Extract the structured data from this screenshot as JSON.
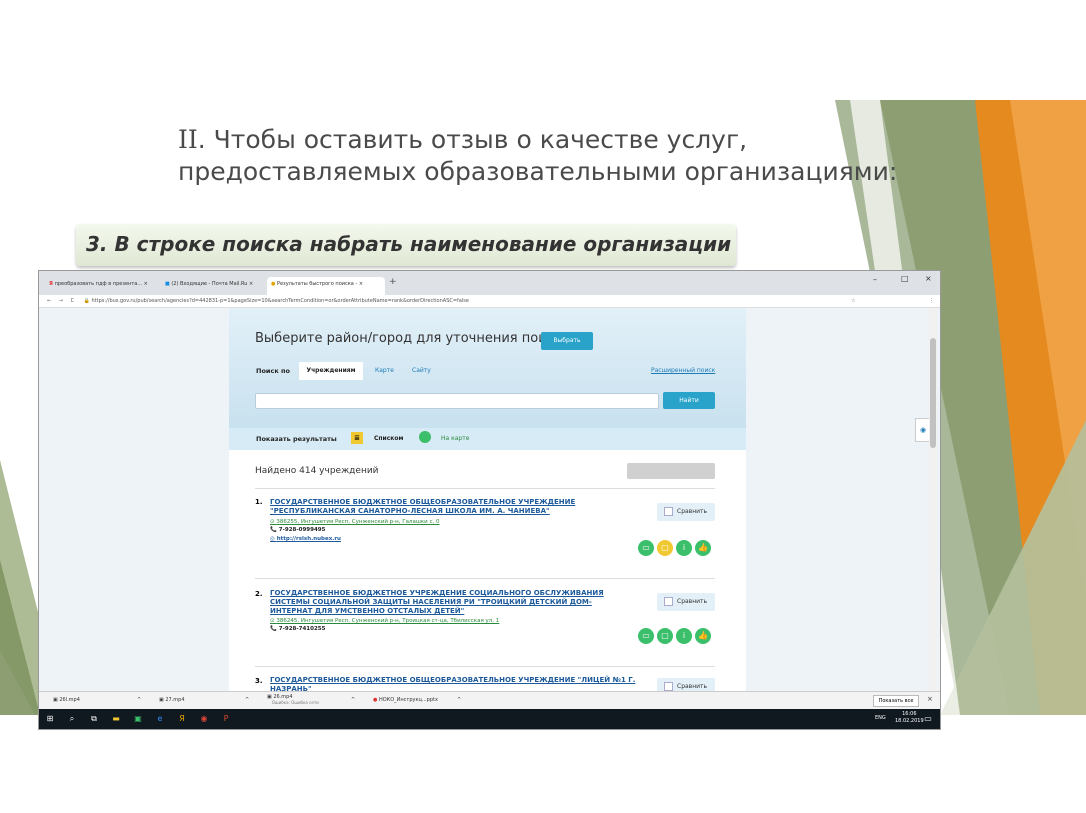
{
  "slide": {
    "title_roman": "II",
    "title_rest": ". Чтобы оставить отзыв о качестве услуг, предоставляемых образовательными организациями:",
    "step_text": "3. В строке поиска набрать наименование организации"
  },
  "browser": {
    "tabs": [
      {
        "label": "преобразовать пдф в презента..."
      },
      {
        "label": "(2) Входящие - Почта Mail.Ru"
      },
      {
        "label": "Результаты быстрого поиска -"
      }
    ],
    "address_url": "https://bus.gov.ru/pub/search/agencies?d=442831-p=1&pageSize=10&searchTermCondition=or&orderAttributeName=rank&orderDirectionASC=false"
  },
  "site": {
    "region_prompt": "Выберите район/город для уточнения поиска",
    "choose_button": "Выбрать",
    "search_by_label": "Поиск по",
    "tabs": [
      "Учреждениям",
      "Карте",
      "Сайту"
    ],
    "advanced_search": "Расширенный поиск",
    "search_input_value": "",
    "find_button": "Найти",
    "show_results_label": "Показать результаты",
    "view_list": "Списком",
    "view_map": "На карте",
    "found_count": "Найдено 414 учреждений",
    "compare_label": "Сравнить",
    "results": [
      {
        "num": "1.",
        "name": "ГОСУДАРСТВЕННОЕ БЮДЖЕТНОЕ ОБЩЕОБРАЗОВАТЕЛЬНОЕ УЧРЕЖДЕНИЕ \"РЕСПУБЛИКАНСКАЯ САНАТОРНО-ЛЕСНАЯ ШКОЛА ИМ. А. ЧАНИЕВА\"",
        "address": "386255, Ингушетия Респ, Сунженский р-н, Галашки с, 0",
        "phone": "7-928-0999495",
        "site": "http://rslsh.nubex.ru"
      },
      {
        "num": "2.",
        "name": "ГОСУДАРСТВЕННОЕ БЮДЖЕТНОЕ УЧРЕЖДЕНИЕ СОЦИАЛЬНОГО ОБСЛУЖИВАНИЯ СИСТЕМЫ СОЦИАЛЬНОЙ ЗАЩИТЫ НАСЕЛЕНИЯ РИ \"ТРОИЦКИЙ ДЕТСКИЙ ДОМ-ИНТЕРНАТ ДЛЯ УМСТВЕННО ОТСТАЛЫХ ДЕТЕЙ\"",
        "address": "386245, Ингушетия Респ, Сунженский р-н, Троицкая ст-ца, Тбилисская ул, 1",
        "phone": "7-928-7410255"
      },
      {
        "num": "3.",
        "name": "ГОСУДАРСТВЕННОЕ БЮДЖЕТНОЕ ОБЩЕОБРАЗОВАТЕЛЬНОЕ УЧРЕЖДЕНИЕ \"ЛИЦЕЙ №1 Г. НАЗРАНЬ\""
      }
    ]
  },
  "downloads": {
    "items": [
      "26l.mp4",
      "27.mp4",
      "26.mp4",
      "НОКО_Инструкц...pptx"
    ],
    "status_26": "Ошибка: Ошибка сети",
    "show_all": "Показать все"
  },
  "taskbar": {
    "lang": "ENG",
    "time": "16:06",
    "date": "18.02.2019"
  },
  "colors": {
    "accent_blue": "#29a3c9",
    "link_blue": "#1d5a9c",
    "green_icon": "#3bbf6a",
    "yellow_icon": "#f0c832",
    "slide_orange": "#e58a1f",
    "slide_green": "#93a872"
  }
}
